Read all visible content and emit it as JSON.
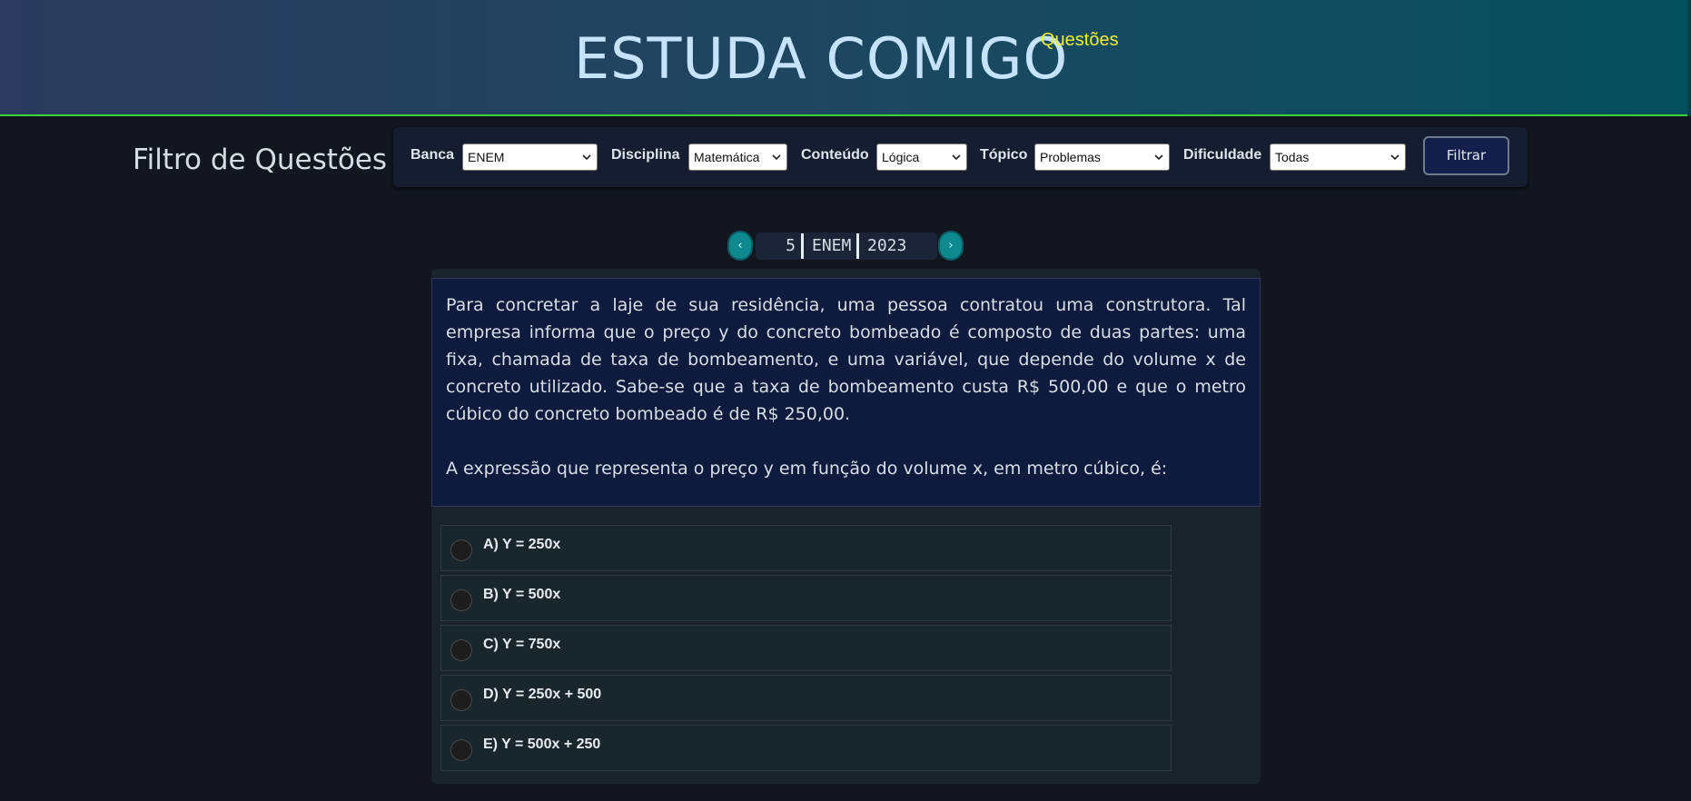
{
  "header": {
    "brand": "ESTUDA COMIGO",
    "brand_sup": "Questões"
  },
  "filter": {
    "title": "Filtro de Questões",
    "fields": [
      {
        "label": "Banca",
        "value": "ENEM"
      },
      {
        "label": "Disciplina",
        "value": "Matemática"
      },
      {
        "label": "Conteúdo",
        "value": "Lógica"
      },
      {
        "label": "Tópico",
        "value": "Problemas"
      },
      {
        "label": "Dificuldade",
        "value": "Todas"
      }
    ],
    "button_label": "Filtrar"
  },
  "pager": {
    "prev_icon": "‹",
    "next_icon": "›",
    "number": "5",
    "bank": "ENEM",
    "year": "2023"
  },
  "question": {
    "paragraph1": "Para concretar a laje de sua residência, uma pessoa contratou uma construtora. Tal empresa informa que o preço y do concreto bombeado é composto de duas partes: uma fixa, chamada de taxa de bombeamento, e uma variável, que depende do volume x de concreto utilizado. Sabe-se que a taxa de bombeamento custa R$ 500,00 e que o metro cúbico do concreto bombeado é de R$ 250,00.",
    "paragraph2": "A expressão que representa o preço y em função do volume x, em metro cúbico, é:",
    "options": [
      {
        "label": "A) Y = 250x"
      },
      {
        "label": "B) Y = 500x"
      },
      {
        "label": "C) Y = 750x"
      },
      {
        "label": "D) Y = 250x + 500"
      },
      {
        "label": "E) Y = 500x + 250"
      }
    ]
  },
  "colors": {
    "accent_green": "#3bd43b",
    "brand_sup": "#f0ef2d",
    "pager_button": "#0e8a8f"
  }
}
